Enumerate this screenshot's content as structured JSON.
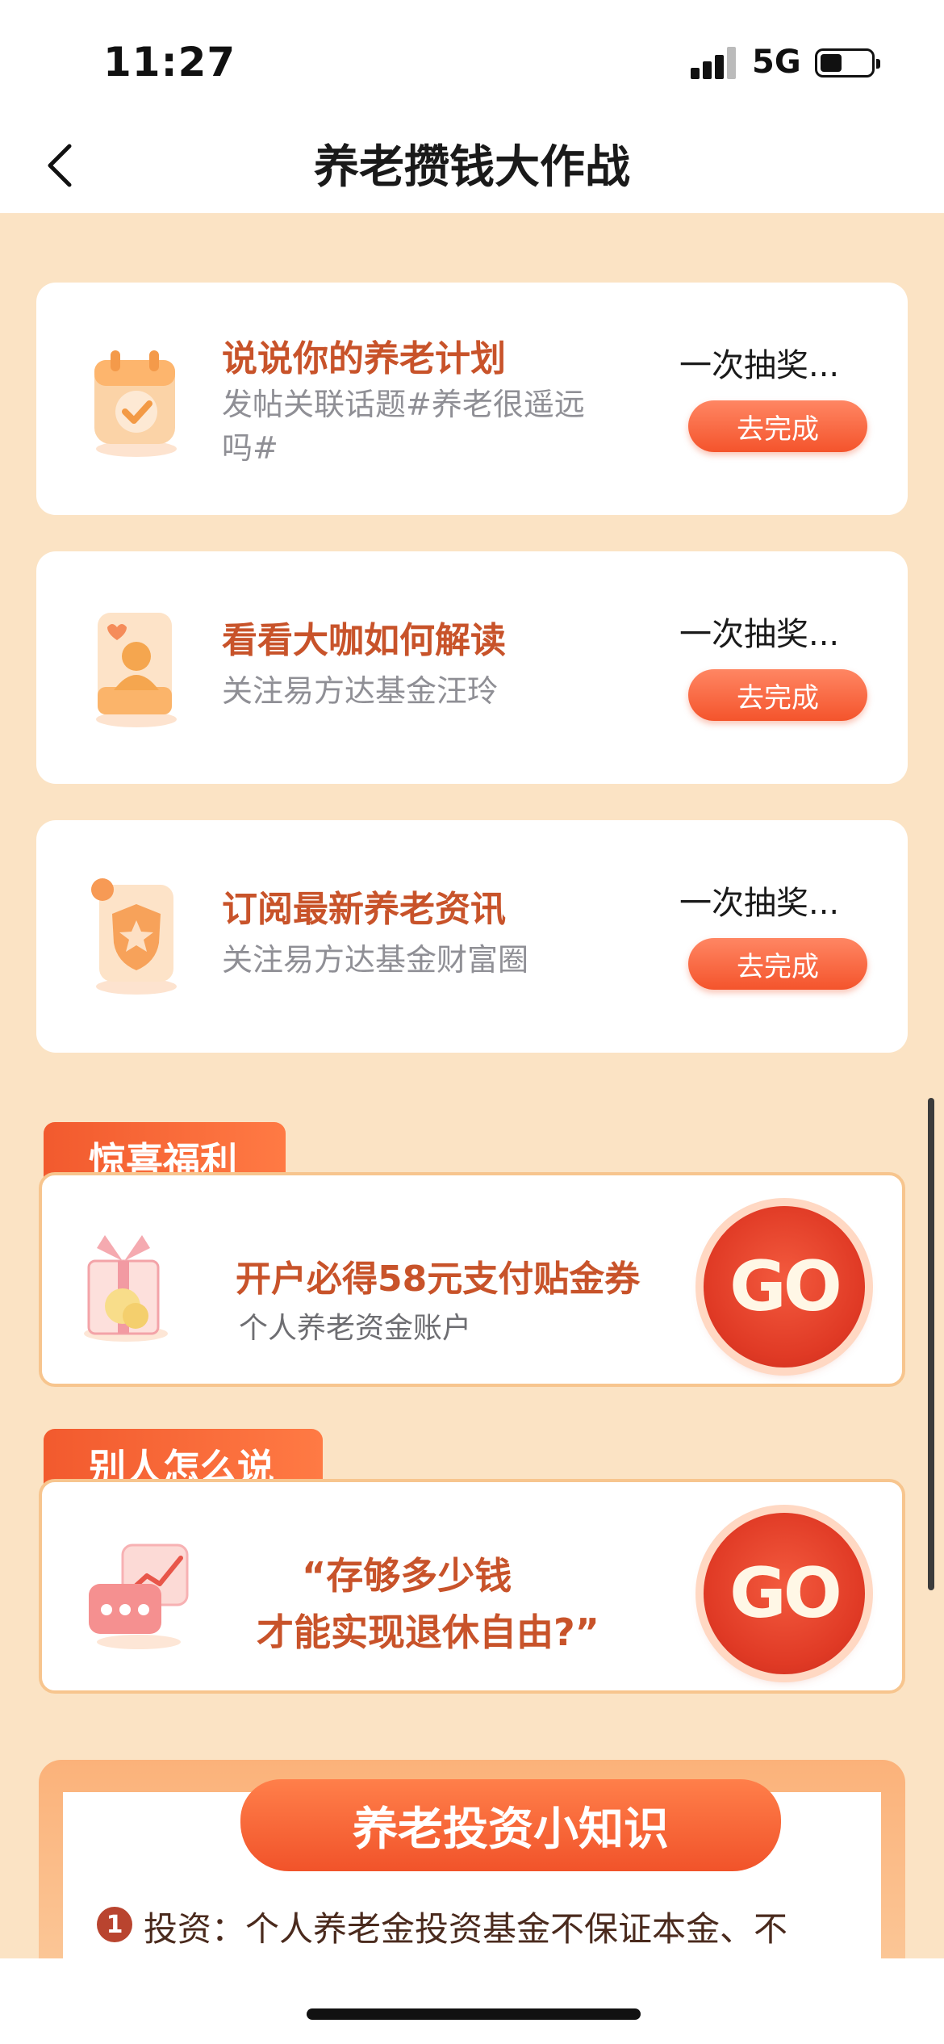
{
  "status_bar": {
    "time": "11:27",
    "network": "5G"
  },
  "nav": {
    "title": "养老攒钱大作战"
  },
  "tasks": [
    {
      "title": "说说你的养老计划",
      "desc": "发帖关联话题#养老很遥远吗#",
      "reward": "一次抽奖...",
      "button": "去完成",
      "icon": "calendar-check-icon"
    },
    {
      "title": "看看大咖如何解读",
      "desc": "关注易方达基金汪玲",
      "reward": "一次抽奖...",
      "button": "去完成",
      "icon": "person-card-icon"
    },
    {
      "title": "订阅最新养老资讯",
      "desc": "关注易方达基金财富圈",
      "reward": "一次抽奖...",
      "button": "去完成",
      "icon": "shield-star-icon"
    }
  ],
  "surprise": {
    "tag": "惊喜福利",
    "title": "开户必得58元支付贴金券",
    "subtitle": "个人养老资金账户",
    "go": "GO"
  },
  "others": {
    "tag": "别人怎么说",
    "quote_line1": "“存够多少钱",
    "quote_line2": "才能实现退休自由?”",
    "go": "GO"
  },
  "knowledge": {
    "title": "养老投资小知识",
    "item_number": "1",
    "item_text": "投资：个人养老金投资基金不保证本金、不"
  }
}
